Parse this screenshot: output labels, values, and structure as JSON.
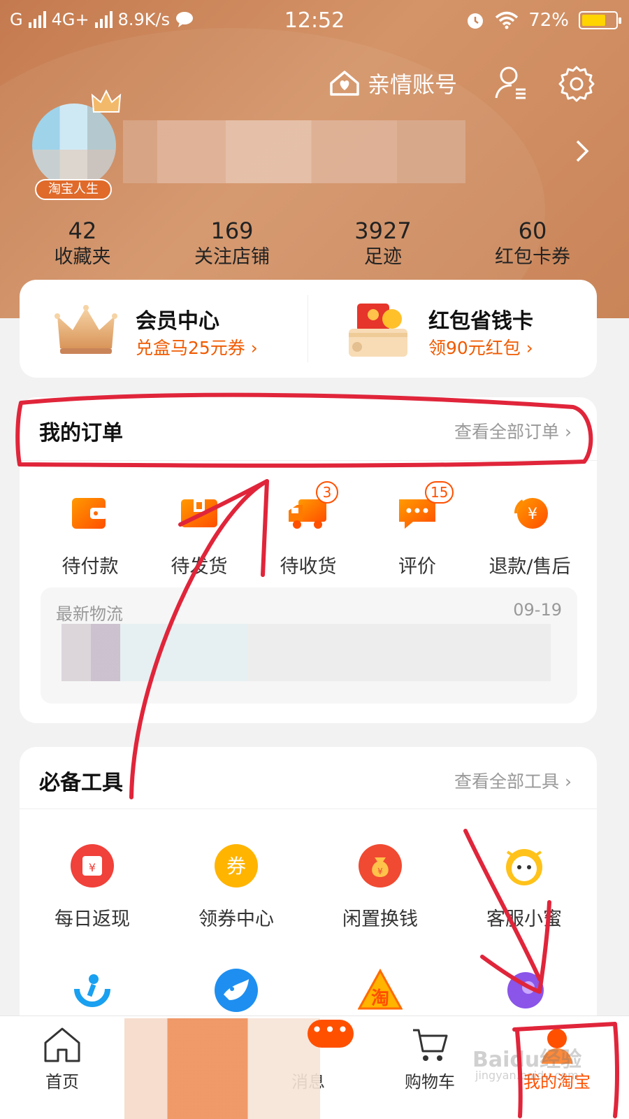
{
  "status_bar": {
    "carrier1": "G",
    "carrier2": "4G+",
    "speed": "8.9K/s",
    "time": "12:52",
    "battery": "72%",
    "battery_level": 0.72
  },
  "header": {
    "family_account": "亲情账号",
    "vip_badge": "淘宝人生"
  },
  "stats": [
    {
      "value": "42",
      "label": "收藏夹"
    },
    {
      "value": "169",
      "label": "关注店铺"
    },
    {
      "value": "3927",
      "label": "足迹"
    },
    {
      "value": "60",
      "label": "红包卡券"
    }
  ],
  "promo": {
    "member_title": "会员中心",
    "member_sub": "兑盒马25元券 ›",
    "redpack_title": "红包省钱卡",
    "redpack_sub": "领90元红包 ›"
  },
  "orders": {
    "title": "我的订单",
    "view_all": "查看全部订单 ›",
    "items": [
      {
        "label": "待付款",
        "badge": ""
      },
      {
        "label": "待发货",
        "badge": ""
      },
      {
        "label": "待收货",
        "badge": "3"
      },
      {
        "label": "评价",
        "badge": "15"
      },
      {
        "label": "退款/售后",
        "badge": ""
      }
    ],
    "logistics_title": "最新物流",
    "logistics_date": "09-19"
  },
  "tools": {
    "title": "必备工具",
    "view_all": "查看全部工具 ›",
    "items": [
      {
        "label": "每日返现",
        "color": "#f0413a"
      },
      {
        "label": "领券中心",
        "color": "#ffb400"
      },
      {
        "label": "闲置换钱",
        "color": "#f04a32"
      },
      {
        "label": "客服小蜜",
        "color": "#ffc21a"
      }
    ]
  },
  "tabbar": {
    "home": "首页",
    "messages": "消息",
    "cart": "购物车",
    "mine": "我的淘宝",
    "message_dots": "•••"
  },
  "watermark": {
    "text": "Baidu经验",
    "sub": "jingyan.baidu.com"
  },
  "colors": {
    "brand_orange": "#ff5000",
    "header_bg": "#c98458",
    "annotation_red": "#e0253a"
  }
}
